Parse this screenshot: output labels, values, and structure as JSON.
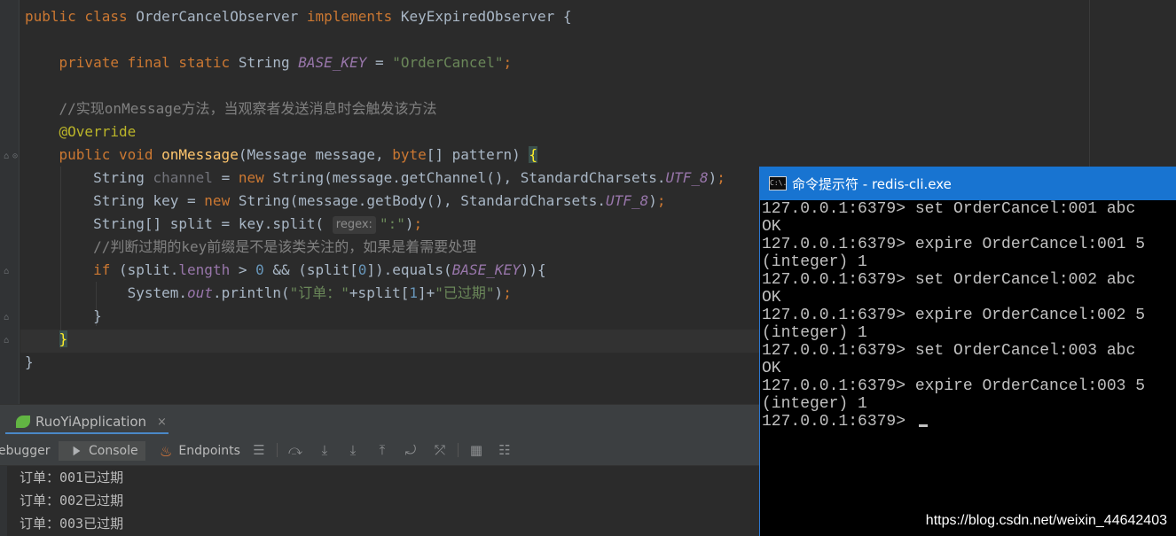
{
  "editor": {
    "code_lines": [
      [
        [
          "kw",
          "public class "
        ],
        [
          "plain",
          "OrderCancelObserver "
        ],
        [
          "kw",
          "implements "
        ],
        [
          "plain",
          "KeyExpiredObserver {"
        ]
      ],
      [],
      [
        [
          "plain",
          "    "
        ],
        [
          "kw",
          "private final static "
        ],
        [
          "plain",
          "String "
        ],
        [
          "fld",
          "BASE_KEY"
        ],
        [
          "plain",
          " = "
        ],
        [
          "str",
          "\"OrderCancel\""
        ],
        [
          "kw",
          ";"
        ]
      ],
      [],
      [
        [
          "cmt",
          "    //实现onMessage方法，当观察者发送消息时会触发该方法"
        ]
      ],
      [
        [
          "plain",
          "    "
        ],
        [
          "ann",
          "@Override"
        ]
      ],
      [
        [
          "plain",
          "    "
        ],
        [
          "kw",
          "public void "
        ],
        [
          "fn",
          "onMessage"
        ],
        [
          "plain",
          "(Message message, "
        ],
        [
          "kw",
          "byte"
        ],
        [
          "plain",
          "[] pattern) "
        ],
        [
          "brace",
          "{"
        ]
      ],
      [
        [
          "plain",
          "        String "
        ],
        [
          "unused",
          "channel"
        ],
        [
          "plain",
          " = "
        ],
        [
          "kw",
          "new "
        ],
        [
          "plain",
          "String(message.getChannel(), StandardCharsets."
        ],
        [
          "fld",
          "UTF_8"
        ],
        [
          "plain",
          ")"
        ],
        [
          "kw",
          ";"
        ]
      ],
      [
        [
          "plain",
          "        String key = "
        ],
        [
          "kw",
          "new "
        ],
        [
          "plain",
          "String(message.getBody(), StandardCharsets."
        ],
        [
          "fld",
          "UTF_8"
        ],
        [
          "plain",
          ")"
        ],
        [
          "kw",
          ";"
        ]
      ],
      [
        [
          "plain",
          "        String[] split = key.split( "
        ],
        [
          "hint",
          "regex:"
        ],
        [
          "str",
          "\":\""
        ],
        [
          "plain",
          ")"
        ],
        [
          "kw",
          ";"
        ]
      ],
      [
        [
          "cmt",
          "        //判断过期的key前缀是不是该类关注的，如果是着需要处理"
        ]
      ],
      [
        [
          "plain",
          "        "
        ],
        [
          "kw",
          "if "
        ],
        [
          "plain",
          "(split."
        ],
        [
          "fldn",
          "length"
        ],
        [
          "plain",
          " > "
        ],
        [
          "num",
          "0"
        ],
        [
          "plain",
          " && (split["
        ],
        [
          "num",
          "0"
        ],
        [
          "plain",
          "]).equals("
        ],
        [
          "fld",
          "BASE_KEY"
        ],
        [
          "plain",
          ")){"
        ]
      ],
      [
        [
          "plain",
          "            System."
        ],
        [
          "fld",
          "out"
        ],
        [
          "plain",
          ".println("
        ],
        [
          "str",
          "\"订单：\""
        ],
        [
          "plain",
          "+split["
        ],
        [
          "num",
          "1"
        ],
        [
          "plain",
          "]+"
        ],
        [
          "str",
          "\"已过期\""
        ],
        [
          "plain",
          ")"
        ],
        [
          "kw",
          ";"
        ]
      ],
      [
        [
          "plain",
          "        }"
        ]
      ],
      [
        [
          "plain",
          "    "
        ],
        [
          "brace",
          "}"
        ]
      ],
      [
        [
          "plain",
          "}"
        ]
      ]
    ]
  },
  "run": {
    "app_name": "RuoYiApplication",
    "close_symbol": "×",
    "debugger_label": "ebugger",
    "console_label": "Console",
    "endpoints_label": "Endpoints",
    "console_output": [
      "订单：001已过期",
      "订单：002已过期",
      "订单：003已过期"
    ]
  },
  "cmd": {
    "title": "命令提示符 - redis-cli.exe",
    "icon_text": "C:\\.",
    "lines": [
      "127.0.0.1:6379> set OrderCancel:001 abc",
      "OK",
      "127.0.0.1:6379> expire OrderCancel:001 5",
      "(integer) 1",
      "127.0.0.1:6379> set OrderCancel:002 abc",
      "OK",
      "127.0.0.1:6379> expire OrderCancel:002 5",
      "(integer) 1",
      "127.0.0.1:6379> set OrderCancel:003 abc",
      "OK",
      "127.0.0.1:6379> expire OrderCancel:003 5",
      "(integer) 1"
    ],
    "prompt": "127.0.0.1:6379> ",
    "watermark": "https://blog.csdn.net/weixin_44642403"
  },
  "colors": {
    "editor_bg": "#2b2b2b",
    "keyword": "#cc7832",
    "string": "#6a8759",
    "comment": "#808080",
    "annotation": "#bbb529",
    "method": "#ffc66d",
    "field": "#9876aa",
    "cmd_title_bar": "#1874d1"
  }
}
